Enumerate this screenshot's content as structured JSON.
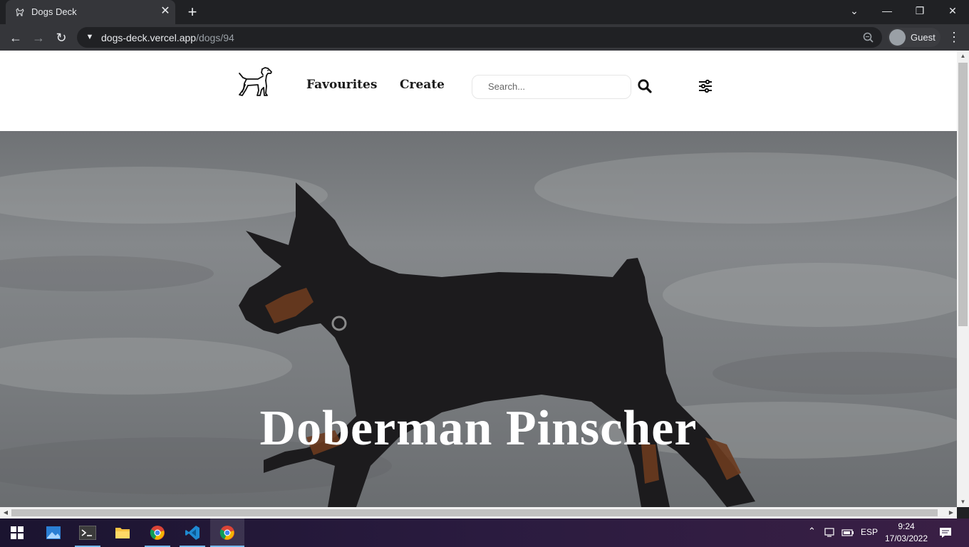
{
  "browser": {
    "tab_title": "Dogs Deck",
    "url_host": "dogs-deck.vercel.app",
    "url_path": "/dogs/94",
    "profile_label": "Guest"
  },
  "site": {
    "nav": {
      "favourites": "Favourites",
      "create": "Create"
    },
    "search": {
      "placeholder": "Search..."
    },
    "hero": {
      "breed_name": "Doberman Pinscher"
    }
  },
  "taskbar": {
    "language": "ESP",
    "time": "9:24",
    "date": "17/03/2022"
  },
  "icons": {
    "logo": "dog-icon",
    "search": "search-icon",
    "filter": "sliders-icon"
  },
  "colors": {
    "chrome_dark": "#202124",
    "chrome_toolbar": "#35363a",
    "accent_taskbar": "#76b9ed"
  }
}
